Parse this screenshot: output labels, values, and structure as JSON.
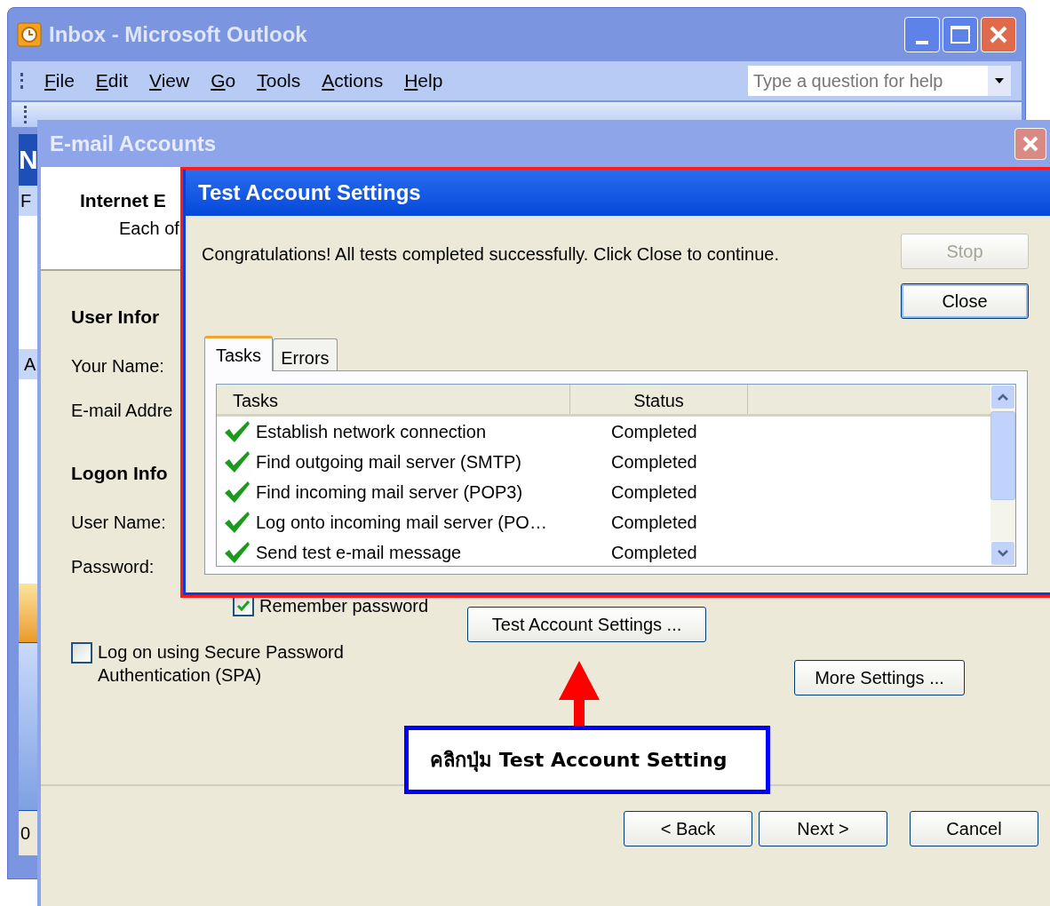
{
  "outlook_window": {
    "title": "Inbox - Microsoft Outlook",
    "menu": [
      "File",
      "Edit",
      "View",
      "Go",
      "Tools",
      "Actions",
      "Help"
    ],
    "help_search": {
      "placeholder": "Type a question for help"
    },
    "navigation_pane": {
      "fragments": [
        "N",
        "F",
        "A"
      ]
    },
    "status_bar": "0"
  },
  "email_accounts_dialog": {
    "title": "E-mail Accounts",
    "header_title": "Internet E",
    "header_subtitle": "Each of",
    "sections": [
      {
        "heading": "User Infor",
        "labels": [
          "Your Name:",
          "E-mail Addre"
        ]
      },
      {
        "heading": "Logon Info",
        "labels": [
          "User Name:",
          "Password:"
        ]
      }
    ],
    "remember_password": {
      "label": "Remember password",
      "checked": true
    },
    "test_button": "Test Account Settings ...",
    "spa": {
      "label": "Log on using Secure Password Authentication (SPA)",
      "checked": false
    },
    "more_settings_button": "More Settings ...",
    "buttons": [
      "< Back",
      "Next >",
      "Cancel"
    ]
  },
  "test_dialog": {
    "title": "Test Account Settings",
    "message": "Congratulations! All tests completed successfully. Click Close to continue.",
    "stop_button": {
      "label": "Stop",
      "disabled": true
    },
    "close_button": {
      "label": "Close",
      "disabled": false
    },
    "tabs": [
      {
        "label": "Tasks",
        "selected": true
      },
      {
        "label": "Errors",
        "selected": false
      }
    ],
    "columns": [
      "Tasks",
      "Status"
    ],
    "rows": [
      {
        "task": "Establish network connection",
        "status": "Completed"
      },
      {
        "task": "Find outgoing mail server (SMTP)",
        "status": "Completed"
      },
      {
        "task": "Find incoming mail server (POP3)",
        "status": "Completed"
      },
      {
        "task": "Log onto incoming mail server (PO…",
        "status": "Completed"
      },
      {
        "task": "Send test e-mail message",
        "status": "Completed"
      }
    ]
  },
  "annotation": {
    "text": "คลิกปุ่ม Test Account Setting"
  }
}
